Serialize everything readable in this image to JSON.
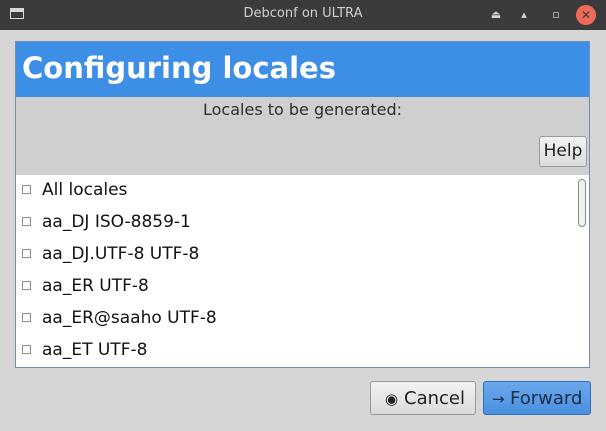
{
  "window": {
    "title": "Debconf on ULTRA",
    "controls": {
      "minimize": "⏏",
      "maximize": "▴",
      "restore": "▫",
      "close": "✕"
    }
  },
  "header": {
    "title": "Configuring locales"
  },
  "subtitle": "Locales to be generated:",
  "help_label": "Help",
  "locales": [
    {
      "label": "All locales",
      "checked": false
    },
    {
      "label": "aa_DJ ISO-8859-1",
      "checked": false
    },
    {
      "label": "aa_DJ.UTF-8 UTF-8",
      "checked": false
    },
    {
      "label": "aa_ER UTF-8",
      "checked": false
    },
    {
      "label": "aa_ER@saaho UTF-8",
      "checked": false
    },
    {
      "label": "aa_ET UTF-8",
      "checked": false
    }
  ],
  "footer": {
    "cancel_label": "Cancel",
    "cancel_icon": "◉",
    "forward_label": "Forward",
    "forward_icon": "→"
  },
  "colors": {
    "header_bg": "#3d8ee5",
    "forward_bg": "#4a90e0",
    "close_button": "#f06a5a"
  }
}
